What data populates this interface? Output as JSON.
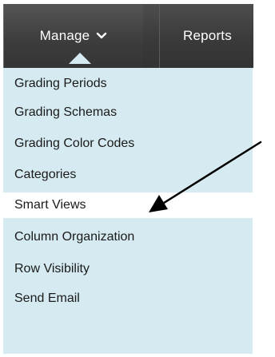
{
  "menubar": {
    "tabs": [
      {
        "label": "Manage",
        "has_dropdown": true,
        "active": true
      },
      {
        "label": "Reports",
        "active": false
      }
    ]
  },
  "dropdown": {
    "items": [
      {
        "label": "Grading Periods"
      },
      {
        "label": "Grading Schemas"
      },
      {
        "label": "Grading Color Codes"
      },
      {
        "label": "Categories"
      },
      {
        "label": "Smart Views",
        "selected": true
      },
      {
        "label": "Column Organization"
      },
      {
        "label": "Row Visibility"
      },
      {
        "label": "Send Email"
      }
    ]
  },
  "annotation": {
    "icon": "arrow-icon",
    "points_to": "Smart Views"
  },
  "colors": {
    "menubar_bg": "#3c3c3c",
    "dropdown_bg": "#d6ebf1",
    "selected_bg": "#ffffff",
    "tab_text": "#ffffff",
    "item_text": "#1a1a1a",
    "arrow": "#000000"
  }
}
